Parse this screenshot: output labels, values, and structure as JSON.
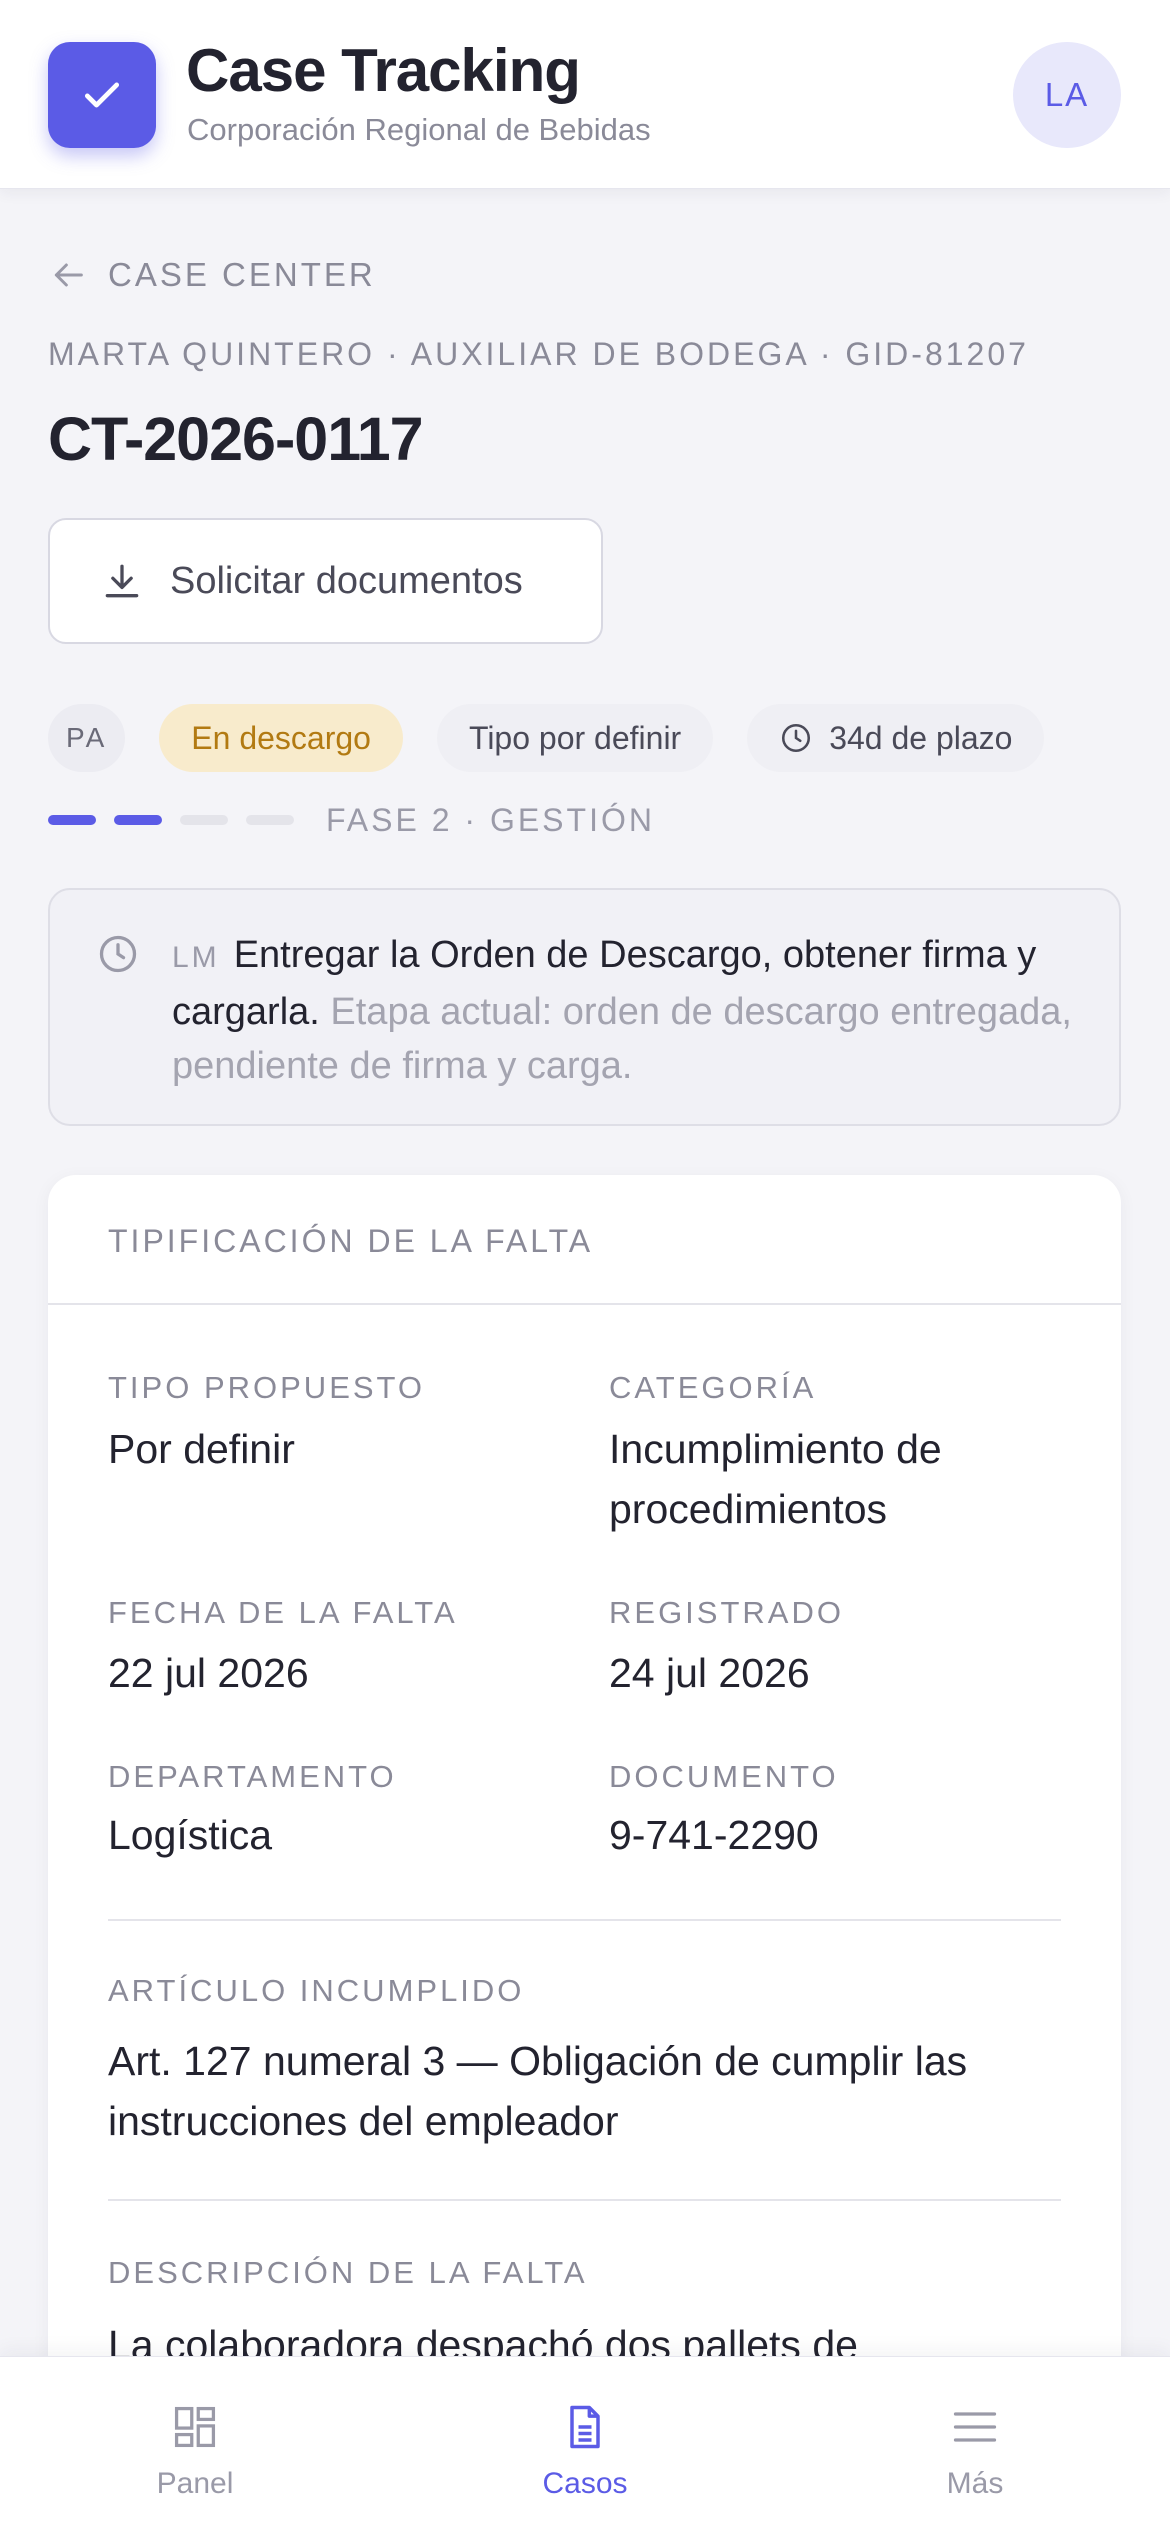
{
  "header": {
    "app_title": "Case Tracking",
    "company": "Corporación Regional de Bebidas",
    "avatar_initials": "LA",
    "logo_icon": "check-icon"
  },
  "breadcrumb": {
    "back_label": "CASE CENTER",
    "meta": "MARTA QUINTERO · AUXILIAR DE BODEGA · GID-81207"
  },
  "case": {
    "id": "CT-2026-0117",
    "request_docs_label": "Solicitar documentos"
  },
  "chips": {
    "initials": "PA",
    "status": "En descargo",
    "type": "Tipo por definir",
    "deadline": "34d de plazo"
  },
  "progress": {
    "completed_steps": 2,
    "total_steps": 4,
    "label": "FASE 2 · GESTIÓN"
  },
  "notice": {
    "initials": "LM",
    "action": "Entregar la Orden de Descargo, obtener firma y cargarla.",
    "detail": "Etapa actual: orden de descargo entregada, pendiente de firma y carga."
  },
  "card": {
    "title": "TIPIFICACIÓN DE LA FALTA",
    "tipo_label": "TIPO PROPUESTO",
    "tipo_value": "Por definir",
    "categoria_label": "CATEGORÍA",
    "categoria_value": "Incumplimiento de procedimientos",
    "fecha_label": "FECHA DE LA FALTA",
    "fecha_value": "22 jul 2026",
    "registrado_label": "REGISTRADO",
    "registrado_value": "24 jul 2026",
    "departamento_label": "DEPARTAMENTO",
    "departamento_value": "Logística",
    "documento_label": "DOCUMENTO",
    "documento_value": "9-741-2290",
    "articulo_label": "ARTÍCULO INCUMPLIDO",
    "articulo_value": "Art. 127 numeral 3 — Obligación de cumplir las instrucciones del empleador",
    "descripcion_label": "DESCRIPCIÓN DE LA FALTA",
    "descripcion_value": "La colaboradora despachó dos pallets de"
  },
  "tabbar": {
    "items": [
      {
        "label": "Panel",
        "icon": "grid-icon"
      },
      {
        "label": "Casos",
        "icon": "document-icon"
      },
      {
        "label": "Más",
        "icon": "menu-icon"
      }
    ],
    "active": "Casos"
  },
  "colors": {
    "accent": "#5b5be6",
    "status_bg": "#f8ebcc",
    "status_text": "#b27a12"
  }
}
